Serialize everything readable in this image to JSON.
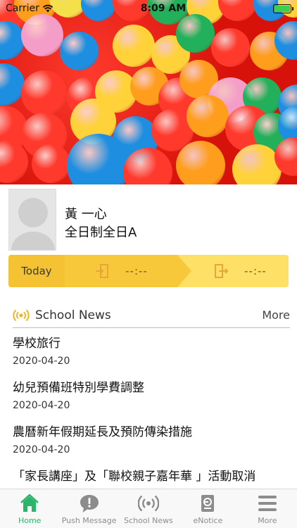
{
  "status_bar": {
    "carrier": "Carrier",
    "time": "8:09 AM",
    "battery_color": "#3ccf4e"
  },
  "profile": {
    "name": "黃 一心",
    "class": "全日制全日A"
  },
  "attendance": {
    "today_label": "Today",
    "check_in_icon": "enter-door-icon",
    "check_in_time": "--:--",
    "check_out_icon": "exit-door-icon",
    "check_out_time": "--:--",
    "colors": {
      "today_bg": "#f5c233",
      "in_bg": "#f7c83a",
      "out_bg": "#ffe066"
    }
  },
  "school_news": {
    "icon": "broadcast-icon",
    "title": "School News",
    "more_label": "More",
    "items": [
      {
        "title": "學校旅行",
        "date": "2020-04-20"
      },
      {
        "title": "幼兒預備班特別學費調整",
        "date": "2020-04-20"
      },
      {
        "title": "農曆新年假期延長及預防傳染措施",
        "date": "2020-04-20"
      },
      {
        "title": "「家長講座」及「聯校親子嘉年華 」活動取消",
        "date": ""
      }
    ]
  },
  "tab_bar": {
    "active_color": "#2bb56b",
    "inactive_color": "#8c8c8c",
    "tabs": [
      {
        "label": "Home",
        "icon": "home-icon"
      },
      {
        "label": "Push Message",
        "icon": "chat-bubble-icon"
      },
      {
        "label": "School News",
        "icon": "broadcast-icon"
      },
      {
        "label": "eNotice",
        "icon": "notice-document-icon"
      },
      {
        "label": "More",
        "icon": "menu-icon"
      }
    ]
  }
}
